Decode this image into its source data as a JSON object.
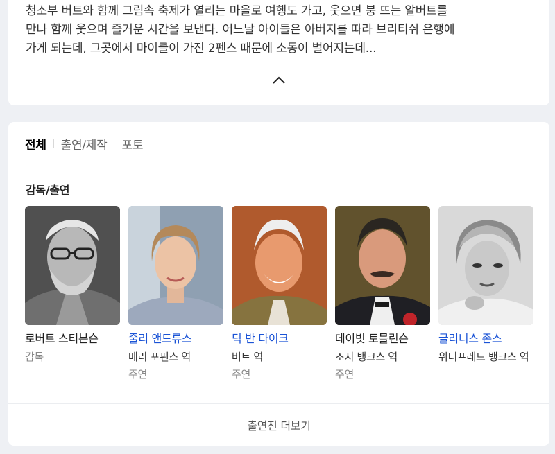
{
  "synopsis": {
    "lines": [
      "청소부 버트와 함께 그림속 축제가 열리는 마을로 여행도 가고, 웃으면 붕 뜨는 알버트를",
      "만나 함께 웃으며 즐거운 시간을 보낸다. 어느날 아이들은 아버지를 따라 브리티쉬 은행에",
      "가게 되는데, 그곳에서 마이클이 가진 2펜스 때문에 소동이 벌어지는데..."
    ],
    "collapse_icon": "chevron-up-icon"
  },
  "tabs": [
    {
      "label": "전체",
      "active": true
    },
    {
      "label": "출연/제작",
      "active": false
    },
    {
      "label": "포토",
      "active": false
    }
  ],
  "section_title": "감독/출연",
  "cast": [
    {
      "name": "로버트 스티븐슨",
      "role": "감독",
      "type": "",
      "link": false
    },
    {
      "name": "줄리 앤드류스",
      "role": "메리 포핀스 역",
      "type": "주연",
      "link": true
    },
    {
      "name": "딕 반 다이크",
      "role": "버트 역",
      "type": "주연",
      "link": true
    },
    {
      "name": "데이빗 토믈린슨",
      "role": "조지 뱅크스 역",
      "type": "주연",
      "link": false
    },
    {
      "name": "글리니스 존스",
      "role": "위니프레드 뱅크스 역",
      "type": "",
      "link": true
    }
  ],
  "footer": {
    "more_label": "출연진 더보기"
  }
}
